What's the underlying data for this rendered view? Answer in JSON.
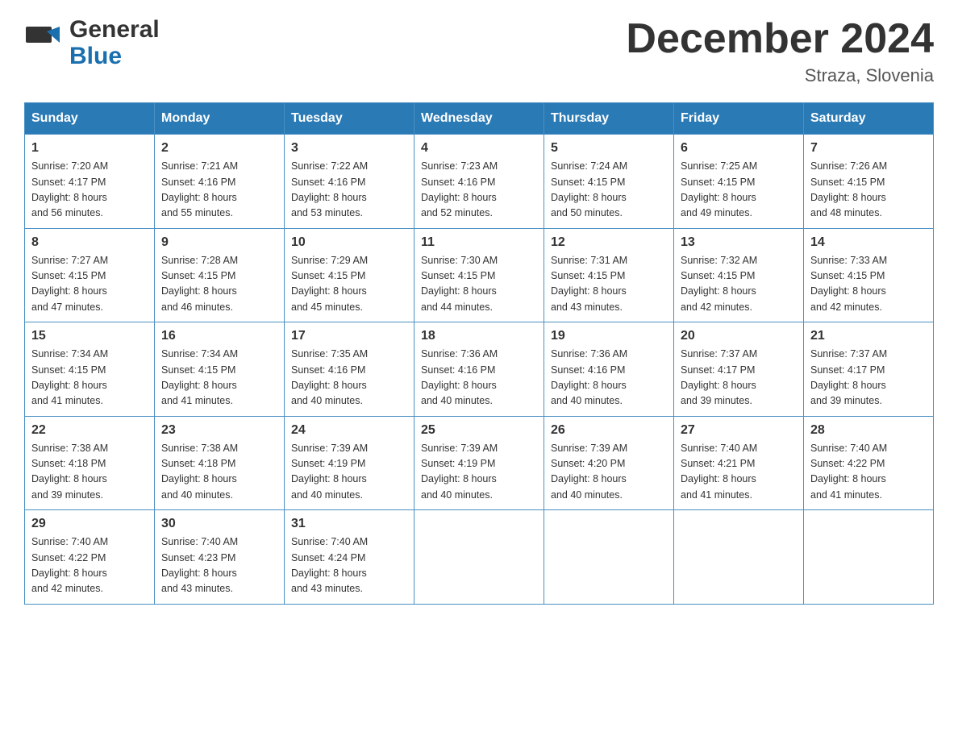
{
  "header": {
    "logo_general": "General",
    "logo_blue": "Blue",
    "month_title": "December 2024",
    "location": "Straza, Slovenia"
  },
  "days_of_week": [
    "Sunday",
    "Monday",
    "Tuesday",
    "Wednesday",
    "Thursday",
    "Friday",
    "Saturday"
  ],
  "weeks": [
    [
      {
        "day": "1",
        "sunrise": "7:20 AM",
        "sunset": "4:17 PM",
        "daylight": "8 hours and 56 minutes."
      },
      {
        "day": "2",
        "sunrise": "7:21 AM",
        "sunset": "4:16 PM",
        "daylight": "8 hours and 55 minutes."
      },
      {
        "day": "3",
        "sunrise": "7:22 AM",
        "sunset": "4:16 PM",
        "daylight": "8 hours and 53 minutes."
      },
      {
        "day": "4",
        "sunrise": "7:23 AM",
        "sunset": "4:16 PM",
        "daylight": "8 hours and 52 minutes."
      },
      {
        "day": "5",
        "sunrise": "7:24 AM",
        "sunset": "4:15 PM",
        "daylight": "8 hours and 50 minutes."
      },
      {
        "day": "6",
        "sunrise": "7:25 AM",
        "sunset": "4:15 PM",
        "daylight": "8 hours and 49 minutes."
      },
      {
        "day": "7",
        "sunrise": "7:26 AM",
        "sunset": "4:15 PM",
        "daylight": "8 hours and 48 minutes."
      }
    ],
    [
      {
        "day": "8",
        "sunrise": "7:27 AM",
        "sunset": "4:15 PM",
        "daylight": "8 hours and 47 minutes."
      },
      {
        "day": "9",
        "sunrise": "7:28 AM",
        "sunset": "4:15 PM",
        "daylight": "8 hours and 46 minutes."
      },
      {
        "day": "10",
        "sunrise": "7:29 AM",
        "sunset": "4:15 PM",
        "daylight": "8 hours and 45 minutes."
      },
      {
        "day": "11",
        "sunrise": "7:30 AM",
        "sunset": "4:15 PM",
        "daylight": "8 hours and 44 minutes."
      },
      {
        "day": "12",
        "sunrise": "7:31 AM",
        "sunset": "4:15 PM",
        "daylight": "8 hours and 43 minutes."
      },
      {
        "day": "13",
        "sunrise": "7:32 AM",
        "sunset": "4:15 PM",
        "daylight": "8 hours and 42 minutes."
      },
      {
        "day": "14",
        "sunrise": "7:33 AM",
        "sunset": "4:15 PM",
        "daylight": "8 hours and 42 minutes."
      }
    ],
    [
      {
        "day": "15",
        "sunrise": "7:34 AM",
        "sunset": "4:15 PM",
        "daylight": "8 hours and 41 minutes."
      },
      {
        "day": "16",
        "sunrise": "7:34 AM",
        "sunset": "4:15 PM",
        "daylight": "8 hours and 41 minutes."
      },
      {
        "day": "17",
        "sunrise": "7:35 AM",
        "sunset": "4:16 PM",
        "daylight": "8 hours and 40 minutes."
      },
      {
        "day": "18",
        "sunrise": "7:36 AM",
        "sunset": "4:16 PM",
        "daylight": "8 hours and 40 minutes."
      },
      {
        "day": "19",
        "sunrise": "7:36 AM",
        "sunset": "4:16 PM",
        "daylight": "8 hours and 40 minutes."
      },
      {
        "day": "20",
        "sunrise": "7:37 AM",
        "sunset": "4:17 PM",
        "daylight": "8 hours and 39 minutes."
      },
      {
        "day": "21",
        "sunrise": "7:37 AM",
        "sunset": "4:17 PM",
        "daylight": "8 hours and 39 minutes."
      }
    ],
    [
      {
        "day": "22",
        "sunrise": "7:38 AM",
        "sunset": "4:18 PM",
        "daylight": "8 hours and 39 minutes."
      },
      {
        "day": "23",
        "sunrise": "7:38 AM",
        "sunset": "4:18 PM",
        "daylight": "8 hours and 40 minutes."
      },
      {
        "day": "24",
        "sunrise": "7:39 AM",
        "sunset": "4:19 PM",
        "daylight": "8 hours and 40 minutes."
      },
      {
        "day": "25",
        "sunrise": "7:39 AM",
        "sunset": "4:19 PM",
        "daylight": "8 hours and 40 minutes."
      },
      {
        "day": "26",
        "sunrise": "7:39 AM",
        "sunset": "4:20 PM",
        "daylight": "8 hours and 40 minutes."
      },
      {
        "day": "27",
        "sunrise": "7:40 AM",
        "sunset": "4:21 PM",
        "daylight": "8 hours and 41 minutes."
      },
      {
        "day": "28",
        "sunrise": "7:40 AM",
        "sunset": "4:22 PM",
        "daylight": "8 hours and 41 minutes."
      }
    ],
    [
      {
        "day": "29",
        "sunrise": "7:40 AM",
        "sunset": "4:22 PM",
        "daylight": "8 hours and 42 minutes."
      },
      {
        "day": "30",
        "sunrise": "7:40 AM",
        "sunset": "4:23 PM",
        "daylight": "8 hours and 43 minutes."
      },
      {
        "day": "31",
        "sunrise": "7:40 AM",
        "sunset": "4:24 PM",
        "daylight": "8 hours and 43 minutes."
      },
      null,
      null,
      null,
      null
    ]
  ],
  "labels": {
    "sunrise": "Sunrise:",
    "sunset": "Sunset:",
    "daylight": "Daylight:"
  }
}
